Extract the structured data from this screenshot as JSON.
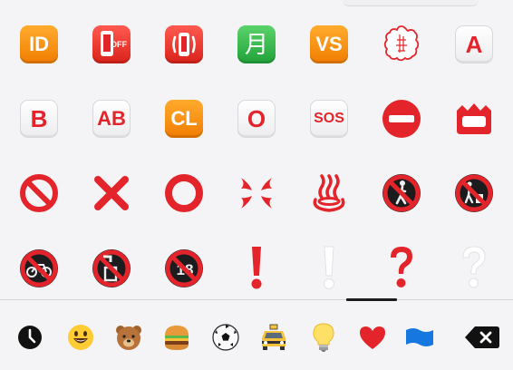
{
  "keyboard": {
    "rows": [
      [
        {
          "name": "id-button-icon",
          "style": "orange",
          "text": "ID"
        },
        {
          "name": "mobile-phone-off-icon",
          "style": "red-phone-off",
          "text": "OFF"
        },
        {
          "name": "vibration-mode-icon",
          "style": "red-vibrate",
          "text": ""
        },
        {
          "name": "japanese-monthly-amount-icon",
          "style": "green",
          "text": "月"
        },
        {
          "name": "vs-button-icon",
          "style": "orange",
          "text": "VS"
        },
        {
          "name": "white-flower-icon",
          "style": "flower",
          "text": ""
        },
        {
          "name": "a-blood-type-icon",
          "style": "white",
          "text": "A"
        }
      ],
      [
        {
          "name": "b-blood-type-icon",
          "style": "white",
          "text": "B"
        },
        {
          "name": "ab-blood-type-icon",
          "style": "white-two",
          "text": "AB"
        },
        {
          "name": "cl-button-icon",
          "style": "orange",
          "text": "CL"
        },
        {
          "name": "o-blood-type-icon",
          "style": "white",
          "text": "O"
        },
        {
          "name": "sos-button-icon",
          "style": "white-tiny",
          "text": "SOS"
        },
        {
          "name": "no-entry-icon",
          "style": "no-entry",
          "text": ""
        },
        {
          "name": "name-badge-icon",
          "style": "name-badge",
          "text": ""
        }
      ],
      [
        {
          "name": "prohibited-icon",
          "style": "prohibited",
          "text": ""
        },
        {
          "name": "cross-mark-icon",
          "style": "cross",
          "text": ""
        },
        {
          "name": "hollow-red-circle-icon",
          "style": "ring",
          "text": ""
        },
        {
          "name": "anger-symbol-icon",
          "style": "anger",
          "text": ""
        },
        {
          "name": "hot-springs-icon",
          "style": "hotsprings",
          "text": ""
        },
        {
          "name": "no-pedestrians-icon",
          "style": "no-pedestrians",
          "text": ""
        },
        {
          "name": "no-littering-icon",
          "style": "no-littering",
          "text": ""
        }
      ],
      [
        {
          "name": "no-bicycles-icon",
          "style": "no-bicycles",
          "text": ""
        },
        {
          "name": "non-potable-water-icon",
          "style": "no-water",
          "text": ""
        },
        {
          "name": "no-one-under-eighteen-icon",
          "style": "no-18",
          "text": "18"
        },
        {
          "name": "red-exclamation-mark-icon",
          "style": "exclaim-red",
          "text": ""
        },
        {
          "name": "white-exclamation-mark-icon",
          "style": "exclaim-white",
          "text": ""
        },
        {
          "name": "red-question-mark-icon",
          "style": "question-red",
          "text": ""
        },
        {
          "name": "white-question-mark-icon",
          "style": "question-white",
          "text": ""
        }
      ]
    ],
    "categories": [
      {
        "name": "recent-category-icon"
      },
      {
        "name": "smileys-category-icon"
      },
      {
        "name": "animals-category-icon"
      },
      {
        "name": "food-category-icon"
      },
      {
        "name": "activity-category-icon"
      },
      {
        "name": "travel-category-icon"
      },
      {
        "name": "objects-category-icon"
      },
      {
        "name": "symbols-category-icon"
      },
      {
        "name": "flags-category-icon"
      }
    ],
    "colors": {
      "red": "#e3252b",
      "orange": "#f58b00",
      "green": "#2fb548",
      "background": "#f4f4f6"
    }
  }
}
